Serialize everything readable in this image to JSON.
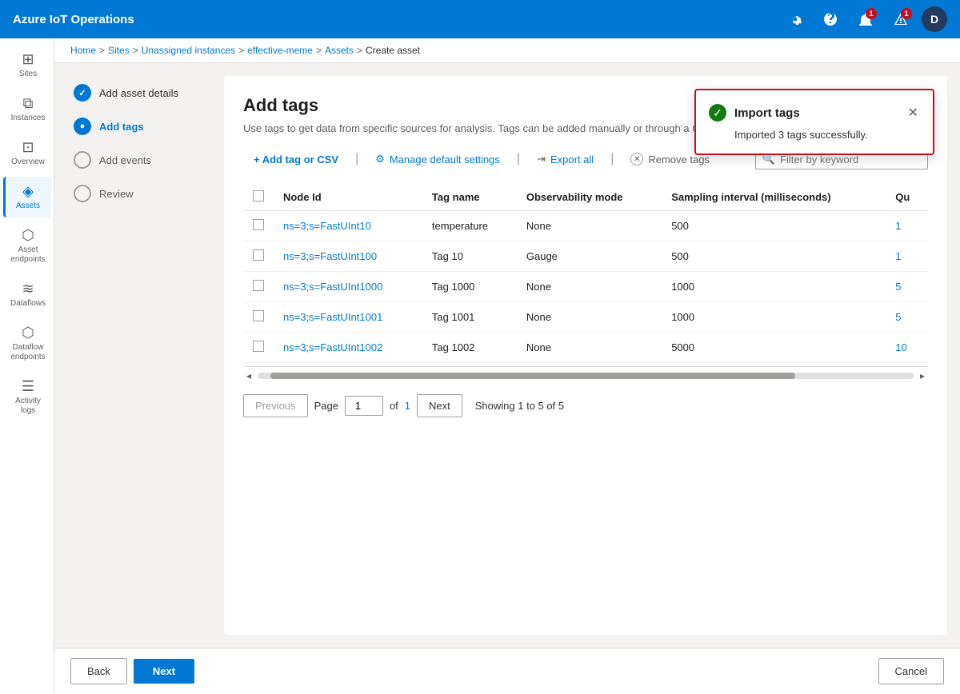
{
  "app": {
    "title": "Azure IoT Operations"
  },
  "topnav": {
    "title": "Azure IoT Operations",
    "icons": [
      "settings",
      "help",
      "notifications",
      "alerts",
      "user"
    ],
    "notifications_count": "1",
    "alerts_count": "1",
    "user_initials": "D"
  },
  "breadcrumb": {
    "items": [
      "Home",
      "Sites",
      "Unassigned instances",
      "effective-meme",
      "Assets"
    ],
    "current": "Create asset"
  },
  "sidebar": {
    "items": [
      {
        "id": "sites",
        "label": "Sites",
        "icon": "⊞"
      },
      {
        "id": "instances",
        "label": "Instances",
        "icon": "⧉"
      },
      {
        "id": "overview",
        "label": "Overview",
        "icon": "⊡"
      },
      {
        "id": "assets",
        "label": "Assets",
        "icon": "◈",
        "active": true
      },
      {
        "id": "asset-endpoints",
        "label": "Asset endpoints",
        "icon": "⬡"
      },
      {
        "id": "dataflows",
        "label": "Dataflows",
        "icon": "⟨⟩"
      },
      {
        "id": "dataflow-endpoints",
        "label": "Dataflow endpoints",
        "icon": "⬡"
      },
      {
        "id": "activity-logs",
        "label": "Activity logs",
        "icon": "☰"
      }
    ]
  },
  "steps": [
    {
      "id": "add-asset-details",
      "label": "Add asset details",
      "state": "done"
    },
    {
      "id": "add-tags",
      "label": "Add tags",
      "state": "active"
    },
    {
      "id": "add-events",
      "label": "Add events",
      "state": "inactive"
    },
    {
      "id": "review",
      "label": "Review",
      "state": "inactive"
    }
  ],
  "page": {
    "title": "Add tags",
    "subtitle": "Use tags to get data from specific sources for analysis. Tags can be added manually or through a CSV file."
  },
  "toolbar": {
    "add_label": "+ Add tag or CSV",
    "manage_label": "Manage default settings",
    "export_label": "Export all",
    "remove_label": "Remove tags",
    "filter_placeholder": "Filter by keyword"
  },
  "table": {
    "columns": [
      "Node Id",
      "Tag name",
      "Observability mode",
      "Sampling interval (milliseconds)",
      "Qu"
    ],
    "rows": [
      {
        "node_id": "ns=3;s=FastUInt10",
        "tag_name": "temperature",
        "observability": "None",
        "sampling": "500",
        "qu": "1"
      },
      {
        "node_id": "ns=3;s=FastUInt100",
        "tag_name": "Tag 10",
        "observability": "Gauge",
        "sampling": "500",
        "qu": "1"
      },
      {
        "node_id": "ns=3;s=FastUInt1000",
        "tag_name": "Tag 1000",
        "observability": "None",
        "sampling": "1000",
        "qu": "5"
      },
      {
        "node_id": "ns=3;s=FastUInt1001",
        "tag_name": "Tag 1001",
        "observability": "None",
        "sampling": "1000",
        "qu": "5"
      },
      {
        "node_id": "ns=3;s=FastUInt1002",
        "tag_name": "Tag 1002",
        "observability": "None",
        "sampling": "5000",
        "qu": "10"
      }
    ]
  },
  "pagination": {
    "previous_label": "Previous",
    "next_label": "Next",
    "page_label": "Page",
    "of_label": "of",
    "total_pages": "1",
    "current_page": "1",
    "showing": "Showing 1 to 5 of 5"
  },
  "footer": {
    "back_label": "Back",
    "next_label": "Next",
    "cancel_label": "Cancel"
  },
  "toast": {
    "title": "Import tags",
    "message": "Imported 3 tags successfully."
  }
}
